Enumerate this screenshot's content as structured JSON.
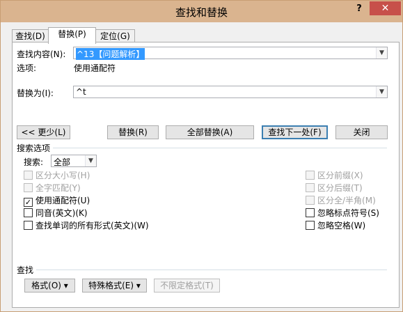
{
  "window": {
    "title": "查找和替换",
    "help": "?",
    "close": "✕"
  },
  "tabs": [
    {
      "label": "查找(D)"
    },
    {
      "label": "替换(P)"
    },
    {
      "label": "定位(G)"
    }
  ],
  "find": {
    "label": "查找内容(N):",
    "value": "^13【问题解析】"
  },
  "options_row": {
    "label": "选项:",
    "value": "使用通配符"
  },
  "replace": {
    "label": "替换为(I):",
    "value": "^t"
  },
  "buttons": {
    "less": "<< 更少(L)",
    "replace": "替换(R)",
    "replace_all": "全部替换(A)",
    "find_next": "查找下一处(F)",
    "close": "关闭"
  },
  "search_options": {
    "heading": "搜索选项",
    "search_label": "搜索:",
    "search_value": "全部",
    "left": [
      {
        "label": "区分大小写(H)",
        "checked": false,
        "disabled": true
      },
      {
        "label": "全字匹配(Y)",
        "checked": false,
        "disabled": true
      },
      {
        "label": "使用通配符(U)",
        "checked": true,
        "disabled": false
      },
      {
        "label": "同音(英文)(K)",
        "checked": false,
        "disabled": false
      },
      {
        "label": "查找单词的所有形式(英文)(W)",
        "checked": false,
        "disabled": false
      }
    ],
    "right": [
      {
        "label": "区分前缀(X)",
        "checked": false,
        "disabled": true
      },
      {
        "label": "区分后缀(T)",
        "checked": false,
        "disabled": true
      },
      {
        "label": "区分全/半角(M)",
        "checked": false,
        "disabled": true
      },
      {
        "label": "忽略标点符号(S)",
        "checked": false,
        "disabled": false
      },
      {
        "label": "忽略空格(W)",
        "checked": false,
        "disabled": false
      }
    ]
  },
  "find_section": {
    "heading": "查找",
    "format": "格式(O) ▾",
    "special": "特殊格式(E) ▾",
    "no_format": "不限定格式(T)"
  },
  "colors": {
    "titlebar": "#dab48f",
    "close": "#c7504a",
    "selection": "#3399ff"
  }
}
